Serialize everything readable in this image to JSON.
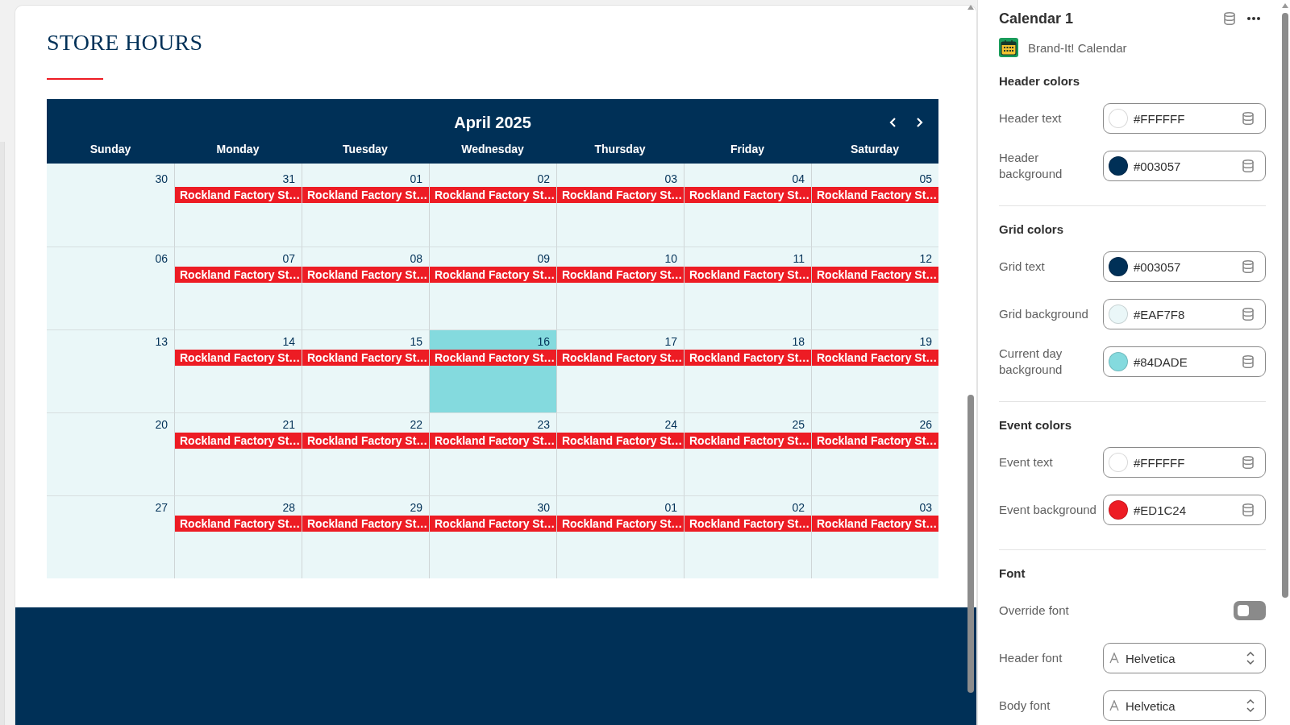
{
  "preview": {
    "title": "STORE HOURS",
    "calendar": {
      "month": "April 2025",
      "weekdays": [
        "Sunday",
        "Monday",
        "Tuesday",
        "Wednesday",
        "Thursday",
        "Friday",
        "Saturday"
      ],
      "weeks": [
        [
          {
            "date": "30",
            "current": false
          },
          {
            "date": "31",
            "current": false,
            "events": [
              "Rockland Factory St…"
            ]
          },
          {
            "date": "01",
            "current": false,
            "events": [
              "Rockland Factory St…"
            ]
          },
          {
            "date": "02",
            "current": false,
            "events": [
              "Rockland Factory St…"
            ]
          },
          {
            "date": "03",
            "current": false,
            "events": [
              "Rockland Factory St…"
            ]
          },
          {
            "date": "04",
            "current": false,
            "events": [
              "Rockland Factory St…"
            ]
          },
          {
            "date": "05",
            "current": false,
            "events": [
              "Rockland Factory St…"
            ]
          }
        ],
        [
          {
            "date": "06",
            "current": false
          },
          {
            "date": "07",
            "current": false,
            "events": [
              "Rockland Factory St…"
            ]
          },
          {
            "date": "08",
            "current": false,
            "events": [
              "Rockland Factory St…"
            ]
          },
          {
            "date": "09",
            "current": false,
            "events": [
              "Rockland Factory St…"
            ]
          },
          {
            "date": "10",
            "current": false,
            "events": [
              "Rockland Factory St…"
            ]
          },
          {
            "date": "11",
            "current": false,
            "events": [
              "Rockland Factory St…"
            ]
          },
          {
            "date": "12",
            "current": false,
            "events": [
              "Rockland Factory St…"
            ]
          }
        ],
        [
          {
            "date": "13",
            "current": false
          },
          {
            "date": "14",
            "current": false,
            "events": [
              "Rockland Factory St…"
            ]
          },
          {
            "date": "15",
            "current": false,
            "events": [
              "Rockland Factory St…"
            ]
          },
          {
            "date": "16",
            "current": true,
            "events": [
              "Rockland Factory St…"
            ]
          },
          {
            "date": "17",
            "current": false,
            "events": [
              "Rockland Factory St…"
            ]
          },
          {
            "date": "18",
            "current": false,
            "events": [
              "Rockland Factory St…"
            ]
          },
          {
            "date": "19",
            "current": false,
            "events": [
              "Rockland Factory St…"
            ]
          }
        ],
        [
          {
            "date": "20",
            "current": false
          },
          {
            "date": "21",
            "current": false,
            "events": [
              "Rockland Factory St…"
            ]
          },
          {
            "date": "22",
            "current": false,
            "events": [
              "Rockland Factory St…"
            ]
          },
          {
            "date": "23",
            "current": false,
            "events": [
              "Rockland Factory St…"
            ]
          },
          {
            "date": "24",
            "current": false,
            "events": [
              "Rockland Factory St…"
            ]
          },
          {
            "date": "25",
            "current": false,
            "events": [
              "Rockland Factory St…"
            ]
          },
          {
            "date": "26",
            "current": false,
            "events": [
              "Rockland Factory St…"
            ]
          }
        ],
        [
          {
            "date": "27",
            "current": false
          },
          {
            "date": "28",
            "current": false,
            "events": [
              "Rockland Factory St…"
            ]
          },
          {
            "date": "29",
            "current": false,
            "events": [
              "Rockland Factory St…"
            ]
          },
          {
            "date": "30",
            "current": false,
            "events": [
              "Rockland Factory St…"
            ]
          },
          {
            "date": "01",
            "current": false,
            "events": [
              "Rockland Factory St…"
            ]
          },
          {
            "date": "02",
            "current": false,
            "events": [
              "Rockland Factory St…"
            ]
          },
          {
            "date": "03",
            "current": false,
            "events": [
              "Rockland Factory St…"
            ]
          }
        ]
      ]
    }
  },
  "panel": {
    "title": "Calendar 1",
    "app": "Brand-It! Calendar",
    "sections": [
      {
        "title": "Header colors",
        "fields": [
          {
            "kind": "color",
            "label": "Header text",
            "value": "#FFFFFF",
            "color": "#ffffff"
          },
          {
            "kind": "color",
            "label": "Header background",
            "value": "#003057",
            "color": "#003057"
          }
        ]
      },
      {
        "title": "Grid colors",
        "fields": [
          {
            "kind": "color",
            "label": "Grid text",
            "value": "#003057",
            "color": "#003057"
          },
          {
            "kind": "color",
            "label": "Grid background",
            "value": "#EAF7F8",
            "color": "#eaf7f8"
          },
          {
            "kind": "color",
            "label": "Current day background",
            "value": "#84DADE",
            "color": "#84dade"
          }
        ]
      },
      {
        "title": "Event colors",
        "fields": [
          {
            "kind": "color",
            "label": "Event text",
            "value": "#FFFFFF",
            "color": "#ffffff"
          },
          {
            "kind": "color",
            "label": "Event background",
            "value": "#ED1C24",
            "color": "#ed1c24"
          }
        ]
      },
      {
        "title": "Font",
        "fields": [
          {
            "kind": "toggle",
            "label": "Override font",
            "on": false
          },
          {
            "kind": "select",
            "label": "Header font",
            "value": "Helvetica"
          },
          {
            "kind": "select",
            "label": "Body font",
            "value": "Helvetica"
          }
        ]
      }
    ]
  }
}
